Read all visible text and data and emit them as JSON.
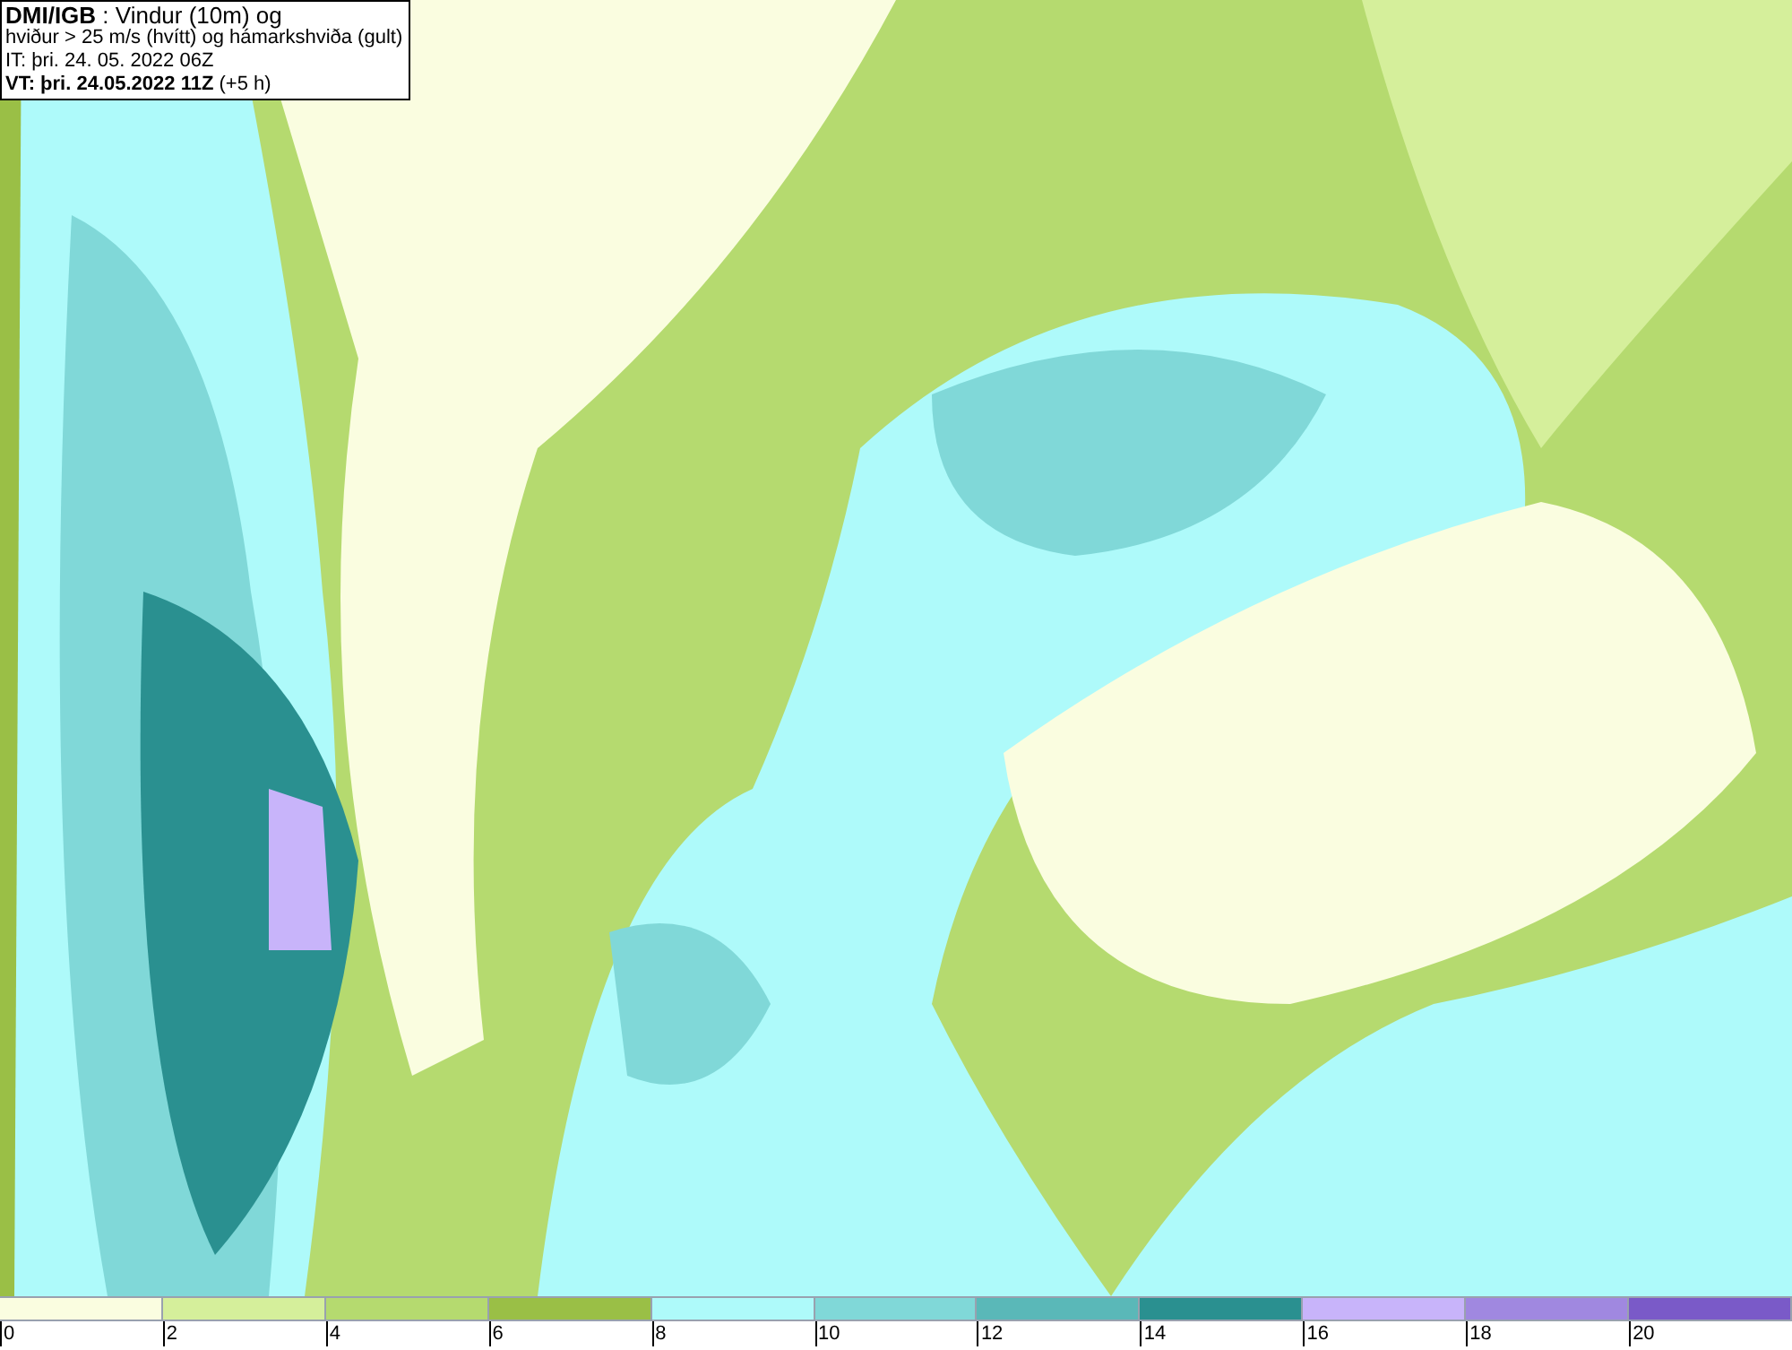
{
  "header": {
    "lines": [
      "**DMI/IGB** : Vindur (10m) og",
      "hviður > 25 m/s (hvítt) og hámarkshviða (gult)",
      "IT: þri. 24. 05. 2022 06Z",
      "**VT: þri. 24.05.2022 11Z** (+5 h)"
    ]
  },
  "legend": {
    "bins": [
      {
        "color": "#fafde0",
        "tick": "0"
      },
      {
        "color": "#d5ef9b",
        "tick": "2"
      },
      {
        "color": "#b5da6f",
        "tick": "4"
      },
      {
        "color": "#9abf46",
        "tick": "6"
      },
      {
        "color": "#aefafa",
        "tick": "8"
      },
      {
        "color": "#80d8d8",
        "tick": "10"
      },
      {
        "color": "#5ab8b8",
        "tick": "12"
      },
      {
        "color": "#2a9090",
        "tick": "14"
      },
      {
        "color": "#c8b4fa",
        "tick": "16"
      },
      {
        "color": "#a088e0",
        "tick": "18"
      },
      {
        "color": "#7a5ac8",
        "tick": "20"
      }
    ]
  }
}
